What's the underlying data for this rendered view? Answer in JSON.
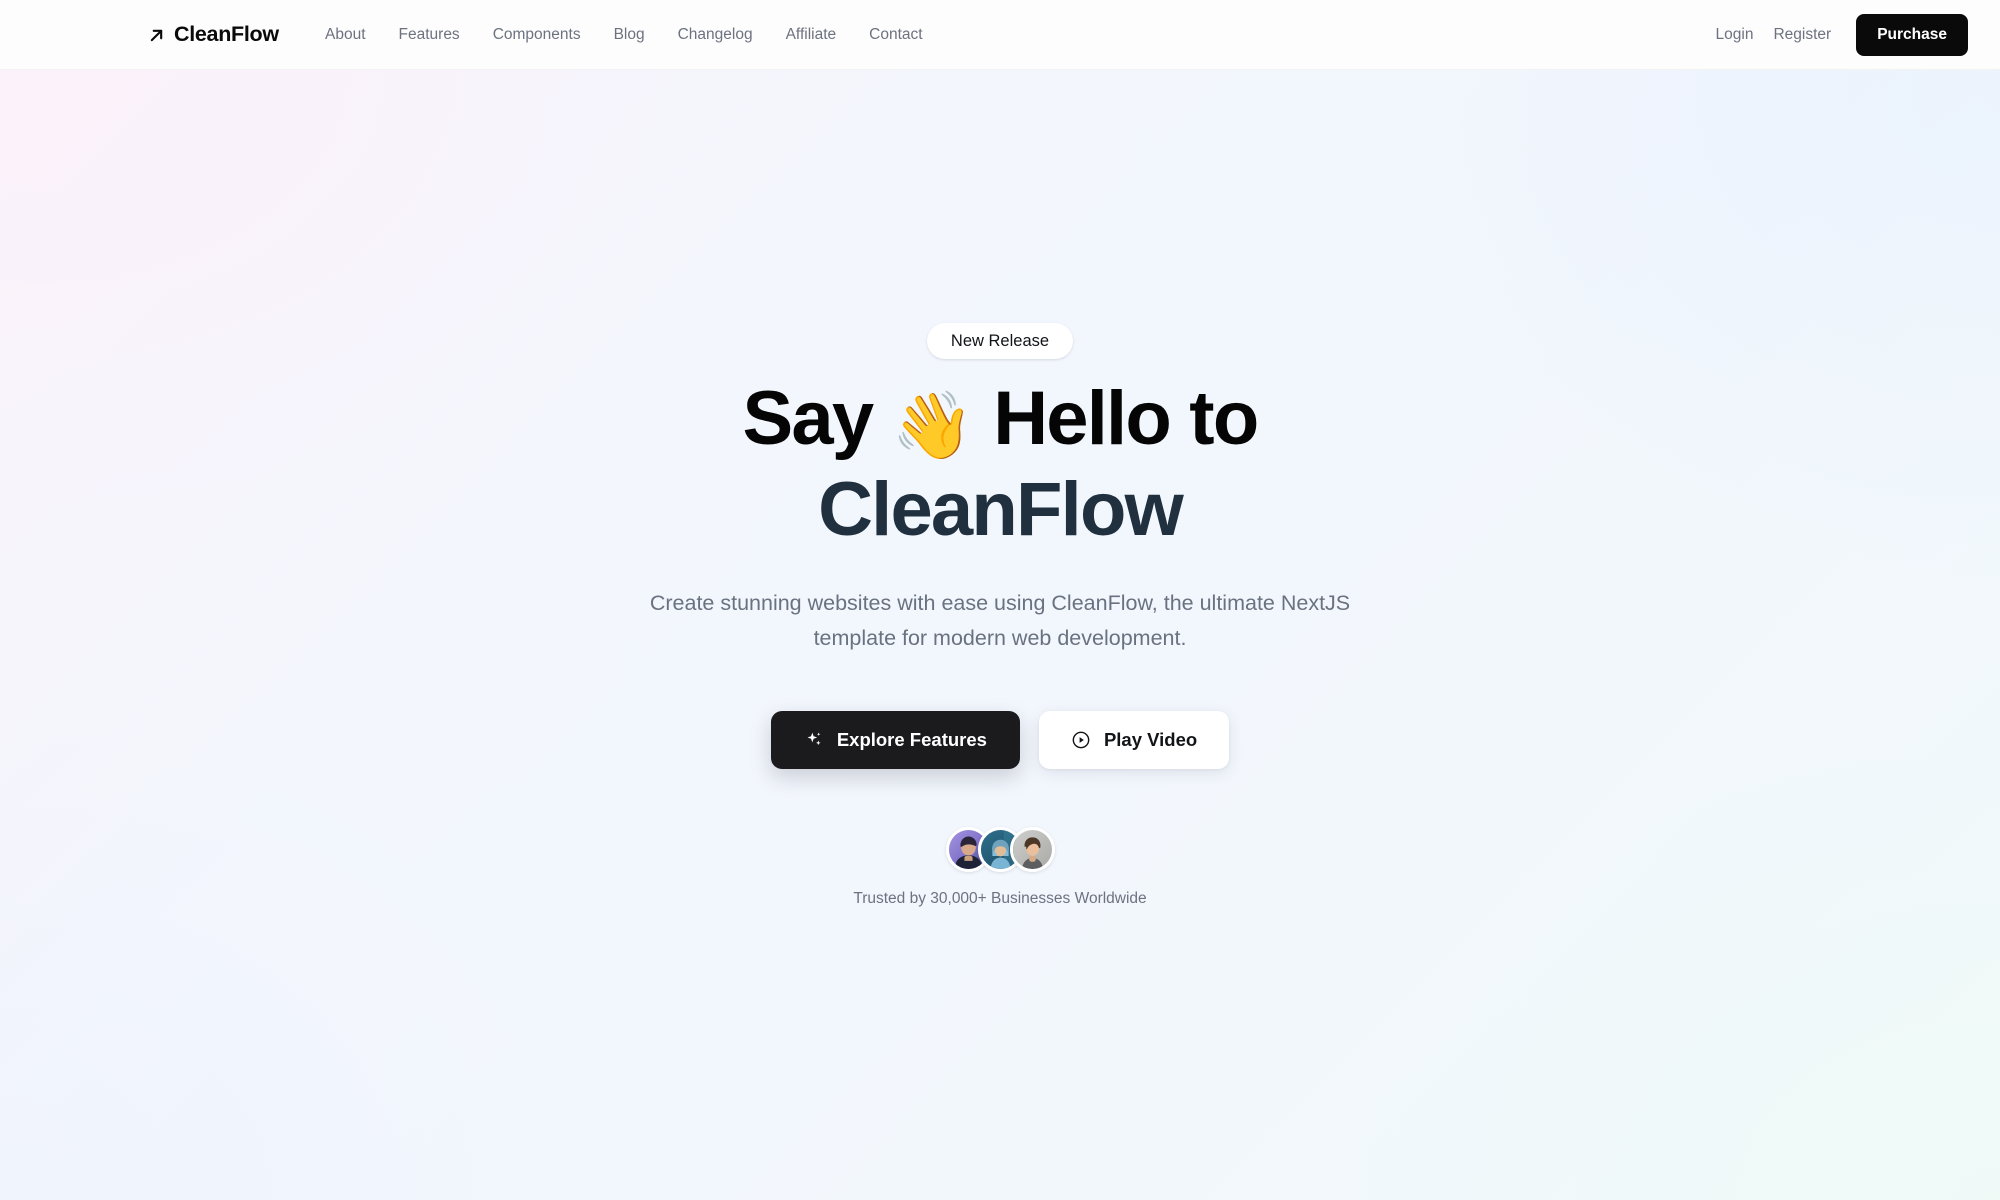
{
  "header": {
    "brand": {
      "name": "CleanFlow",
      "icon": "arrow-up-right-icon"
    },
    "nav": [
      {
        "label": "About"
      },
      {
        "label": "Features"
      },
      {
        "label": "Components"
      },
      {
        "label": "Blog"
      },
      {
        "label": "Changelog"
      },
      {
        "label": "Affiliate"
      },
      {
        "label": "Contact"
      }
    ],
    "login_label": "Login",
    "register_label": "Register",
    "purchase_label": "Purchase"
  },
  "hero": {
    "badge_label": "New Release",
    "headline_line1_before": "Say ",
    "headline_emoji": "👋",
    "headline_line1_after": " Hello to",
    "headline_line2": "CleanFlow",
    "subtitle": "Create stunning websites with ease using CleanFlow, the ultimate NextJS template for modern web development.",
    "primary_cta": {
      "label": "Explore Features",
      "icon": "sparkles-icon"
    },
    "secondary_cta": {
      "label": "Play Video",
      "icon": "play-circle-icon"
    },
    "avatars": [
      {
        "name": "avatar-1",
        "bg": "#8b7fd4",
        "skin": "#e8b894",
        "hair": "#2b2438",
        "shirt": "#1e2236"
      },
      {
        "name": "avatar-2",
        "bg": "#2d6e87",
        "skin": "#e2c09a",
        "hair": "#6fa3bd",
        "shirt": "#79b4d4"
      },
      {
        "name": "avatar-3",
        "bg": "#b8b8b8",
        "skin": "#e9bf9c",
        "hair": "#4a3726",
        "shirt": "#585a5c"
      }
    ],
    "trusted_text": "Trusted by 30,000+ Businesses Worldwide"
  },
  "colors": {
    "accent_dark": "#0a0a0a",
    "headline_dark": "#050505",
    "headline_slate": "#20303f",
    "muted_text": "#6c7280",
    "page_bg": "#f2f6fd",
    "grad_pink": "#faebf8",
    "grad_blue": "#e9f1fe",
    "grad_mint": "#eefaf6"
  }
}
